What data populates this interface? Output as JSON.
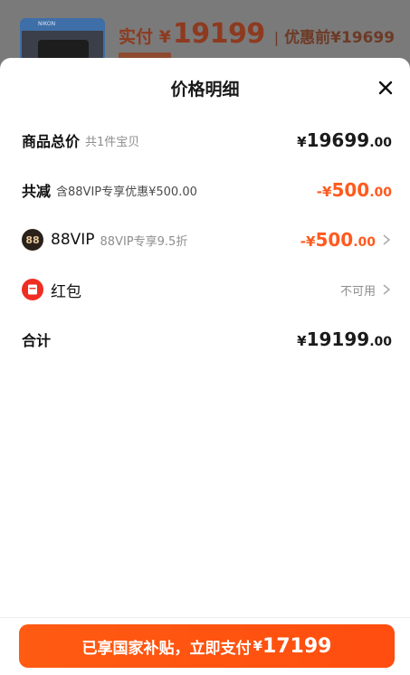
{
  "background": {
    "price_prefix": "实付 ¥",
    "price": "19199",
    "separator": "|",
    "original_price": "优惠前¥19699"
  },
  "sheet": {
    "title": "价格明细"
  },
  "rows": {
    "total": {
      "label": "商品总价",
      "sub": "共1件宝贝",
      "currency": "¥",
      "int": "19699",
      "dec": ".00"
    },
    "discount": {
      "label": "共减",
      "sub": "含88VIP专享优惠¥500.00",
      "currency": "-¥",
      "int": "500",
      "dec": ".00"
    },
    "vip": {
      "icon_text": "88",
      "label": "88VIP",
      "sub": "88VIP专享9.5折",
      "currency": "-¥",
      "int": "500",
      "dec": ".00"
    },
    "hongbao": {
      "label": "红包",
      "status": "不可用"
    },
    "sum": {
      "label": "合计",
      "currency": "¥",
      "int": "19199",
      "dec": ".00"
    }
  },
  "footer": {
    "button_text": "已享国家补贴，立即支付",
    "currency": "¥",
    "amount": "17199"
  },
  "colors": {
    "accent": "#ff5a1f",
    "button": "#ff5b12",
    "hongbao": "#f02d22"
  }
}
